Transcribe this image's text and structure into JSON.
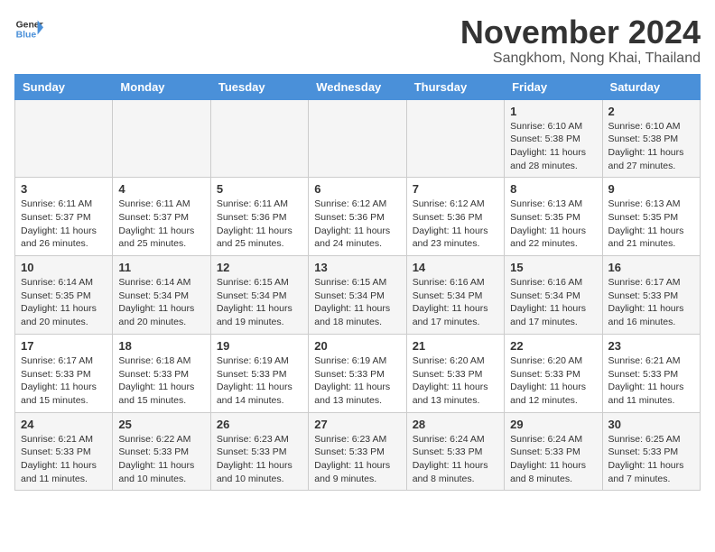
{
  "logo": {
    "line1": "General",
    "line2": "Blue"
  },
  "title": "November 2024",
  "location": "Sangkhom, Nong Khai, Thailand",
  "weekdays": [
    "Sunday",
    "Monday",
    "Tuesday",
    "Wednesday",
    "Thursday",
    "Friday",
    "Saturday"
  ],
  "weeks": [
    [
      {
        "day": "",
        "info": ""
      },
      {
        "day": "",
        "info": ""
      },
      {
        "day": "",
        "info": ""
      },
      {
        "day": "",
        "info": ""
      },
      {
        "day": "",
        "info": ""
      },
      {
        "day": "1",
        "info": "Sunrise: 6:10 AM\nSunset: 5:38 PM\nDaylight: 11 hours and 28 minutes."
      },
      {
        "day": "2",
        "info": "Sunrise: 6:10 AM\nSunset: 5:38 PM\nDaylight: 11 hours and 27 minutes."
      }
    ],
    [
      {
        "day": "3",
        "info": "Sunrise: 6:11 AM\nSunset: 5:37 PM\nDaylight: 11 hours and 26 minutes."
      },
      {
        "day": "4",
        "info": "Sunrise: 6:11 AM\nSunset: 5:37 PM\nDaylight: 11 hours and 25 minutes."
      },
      {
        "day": "5",
        "info": "Sunrise: 6:11 AM\nSunset: 5:36 PM\nDaylight: 11 hours and 25 minutes."
      },
      {
        "day": "6",
        "info": "Sunrise: 6:12 AM\nSunset: 5:36 PM\nDaylight: 11 hours and 24 minutes."
      },
      {
        "day": "7",
        "info": "Sunrise: 6:12 AM\nSunset: 5:36 PM\nDaylight: 11 hours and 23 minutes."
      },
      {
        "day": "8",
        "info": "Sunrise: 6:13 AM\nSunset: 5:35 PM\nDaylight: 11 hours and 22 minutes."
      },
      {
        "day": "9",
        "info": "Sunrise: 6:13 AM\nSunset: 5:35 PM\nDaylight: 11 hours and 21 minutes."
      }
    ],
    [
      {
        "day": "10",
        "info": "Sunrise: 6:14 AM\nSunset: 5:35 PM\nDaylight: 11 hours and 20 minutes."
      },
      {
        "day": "11",
        "info": "Sunrise: 6:14 AM\nSunset: 5:34 PM\nDaylight: 11 hours and 20 minutes."
      },
      {
        "day": "12",
        "info": "Sunrise: 6:15 AM\nSunset: 5:34 PM\nDaylight: 11 hours and 19 minutes."
      },
      {
        "day": "13",
        "info": "Sunrise: 6:15 AM\nSunset: 5:34 PM\nDaylight: 11 hours and 18 minutes."
      },
      {
        "day": "14",
        "info": "Sunrise: 6:16 AM\nSunset: 5:34 PM\nDaylight: 11 hours and 17 minutes."
      },
      {
        "day": "15",
        "info": "Sunrise: 6:16 AM\nSunset: 5:34 PM\nDaylight: 11 hours and 17 minutes."
      },
      {
        "day": "16",
        "info": "Sunrise: 6:17 AM\nSunset: 5:33 PM\nDaylight: 11 hours and 16 minutes."
      }
    ],
    [
      {
        "day": "17",
        "info": "Sunrise: 6:17 AM\nSunset: 5:33 PM\nDaylight: 11 hours and 15 minutes."
      },
      {
        "day": "18",
        "info": "Sunrise: 6:18 AM\nSunset: 5:33 PM\nDaylight: 11 hours and 15 minutes."
      },
      {
        "day": "19",
        "info": "Sunrise: 6:19 AM\nSunset: 5:33 PM\nDaylight: 11 hours and 14 minutes."
      },
      {
        "day": "20",
        "info": "Sunrise: 6:19 AM\nSunset: 5:33 PM\nDaylight: 11 hours and 13 minutes."
      },
      {
        "day": "21",
        "info": "Sunrise: 6:20 AM\nSunset: 5:33 PM\nDaylight: 11 hours and 13 minutes."
      },
      {
        "day": "22",
        "info": "Sunrise: 6:20 AM\nSunset: 5:33 PM\nDaylight: 11 hours and 12 minutes."
      },
      {
        "day": "23",
        "info": "Sunrise: 6:21 AM\nSunset: 5:33 PM\nDaylight: 11 hours and 11 minutes."
      }
    ],
    [
      {
        "day": "24",
        "info": "Sunrise: 6:21 AM\nSunset: 5:33 PM\nDaylight: 11 hours and 11 minutes."
      },
      {
        "day": "25",
        "info": "Sunrise: 6:22 AM\nSunset: 5:33 PM\nDaylight: 11 hours and 10 minutes."
      },
      {
        "day": "26",
        "info": "Sunrise: 6:23 AM\nSunset: 5:33 PM\nDaylight: 11 hours and 10 minutes."
      },
      {
        "day": "27",
        "info": "Sunrise: 6:23 AM\nSunset: 5:33 PM\nDaylight: 11 hours and 9 minutes."
      },
      {
        "day": "28",
        "info": "Sunrise: 6:24 AM\nSunset: 5:33 PM\nDaylight: 11 hours and 8 minutes."
      },
      {
        "day": "29",
        "info": "Sunrise: 6:24 AM\nSunset: 5:33 PM\nDaylight: 11 hours and 8 minutes."
      },
      {
        "day": "30",
        "info": "Sunrise: 6:25 AM\nSunset: 5:33 PM\nDaylight: 11 hours and 7 minutes."
      }
    ]
  ]
}
